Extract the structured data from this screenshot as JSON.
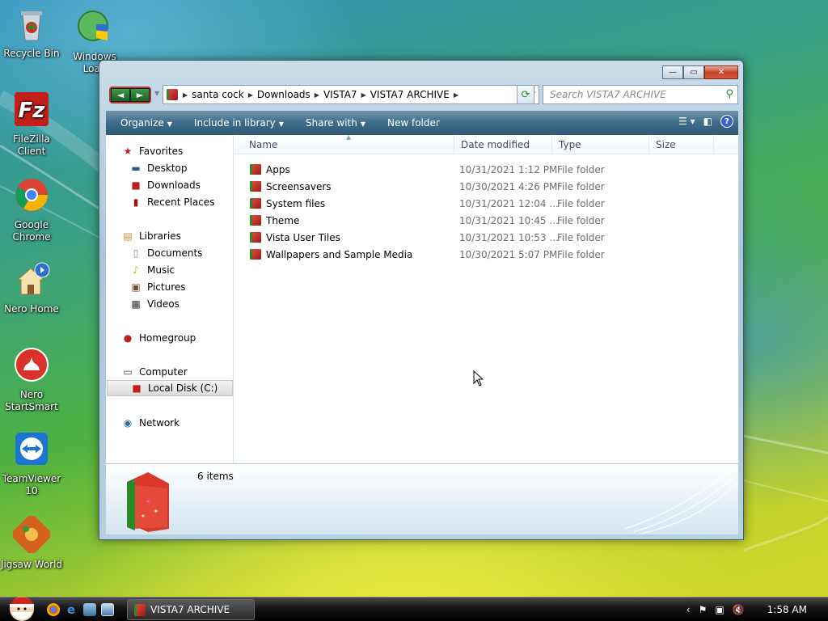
{
  "desktop": {
    "icons": [
      {
        "name": "recycle-bin",
        "label": "Recycle Bin"
      },
      {
        "name": "windows-load",
        "label": "Windows Load"
      },
      {
        "name": "filezilla",
        "label": "FileZilla Client"
      },
      {
        "name": "chrome",
        "label": "Google Chrome"
      },
      {
        "name": "nero-home",
        "label": "Nero Home"
      },
      {
        "name": "nero-startsmart",
        "label": "Nero StartSmart"
      },
      {
        "name": "teamviewer",
        "label": "TeamViewer 10"
      },
      {
        "name": "jigsaw-world",
        "label": "Jigsaw World"
      }
    ]
  },
  "window": {
    "buttons": {
      "minimize": "—",
      "maximize": "▭",
      "close": "✕"
    },
    "nav": {
      "back": "◄",
      "forward": "►"
    },
    "address": {
      "crumbs": [
        "santa cock",
        "Downloads",
        "VISTA7",
        "VISTA7 ARCHIVE"
      ]
    },
    "search": {
      "placeholder": "Search VISTA7 ARCHIVE"
    },
    "toolbar": {
      "organize": "Organize",
      "include": "Include in library",
      "share": "Share with",
      "new_folder": "New folder"
    },
    "navpane": {
      "favorites": "Favorites",
      "desktop": "Desktop",
      "downloads": "Downloads",
      "recent": "Recent Places",
      "libraries": "Libraries",
      "documents": "Documents",
      "music": "Music",
      "pictures": "Pictures",
      "videos": "Videos",
      "homegroup": "Homegroup",
      "computer": "Computer",
      "local_disk": "Local Disk (C:)",
      "network": "Network"
    },
    "columns": {
      "name": "Name",
      "date": "Date modified",
      "type": "Type",
      "size": "Size"
    },
    "files": [
      {
        "name": "Apps",
        "date": "10/31/2021 1:12 PM",
        "type": "File folder"
      },
      {
        "name": "Screensavers",
        "date": "10/30/2021 4:26 PM",
        "type": "File folder"
      },
      {
        "name": "System files",
        "date": "10/31/2021 12:04 ...",
        "type": "File folder"
      },
      {
        "name": "Theme",
        "date": "10/31/2021 10:45 ...",
        "type": "File folder"
      },
      {
        "name": "Vista User Tiles",
        "date": "10/31/2021 10:53 ...",
        "type": "File folder"
      },
      {
        "name": "Wallpapers and Sample Media",
        "date": "10/30/2021 5:07 PM",
        "type": "File folder"
      }
    ],
    "details": {
      "count": "6 items"
    }
  },
  "taskbar": {
    "task_label": "VISTA7 ARCHIVE",
    "clock": "1:58 AM"
  },
  "colors": {
    "accent_red": "#c5432a",
    "accent_green": "#2a8a2a",
    "toolbar": "#3f6c88"
  }
}
